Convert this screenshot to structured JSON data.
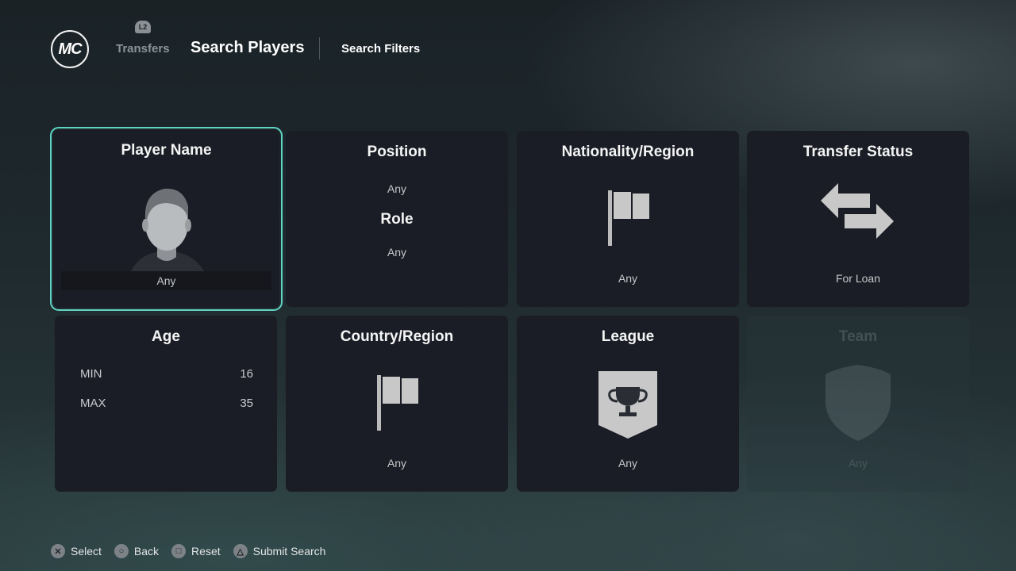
{
  "header": {
    "logo_text": "MC",
    "l2_label": "L2",
    "tab_transfers": "Transfers",
    "tab_search_players": "Search Players",
    "tab_search_filters": "Search Filters"
  },
  "cards": {
    "player_name": {
      "title": "Player Name",
      "value": "Any"
    },
    "position": {
      "title": "Position",
      "value": "Any",
      "role_title": "Role",
      "role_value": "Any"
    },
    "nationality": {
      "title": "Nationality/Region",
      "value": "Any"
    },
    "transfer_status": {
      "title": "Transfer Status",
      "value": "For Loan"
    },
    "age": {
      "title": "Age",
      "min_label": "MIN",
      "min_value": "16",
      "max_label": "MAX",
      "max_value": "35"
    },
    "country": {
      "title": "Country/Region",
      "value": "Any"
    },
    "league": {
      "title": "League",
      "value": "Any"
    },
    "team": {
      "title": "Team",
      "value": "Any"
    }
  },
  "footer": {
    "select": "Select",
    "back": "Back",
    "reset": "Reset",
    "submit": "Submit Search"
  },
  "colors": {
    "accent": "#5fd3c4",
    "card_bg": "#1a1d25"
  }
}
